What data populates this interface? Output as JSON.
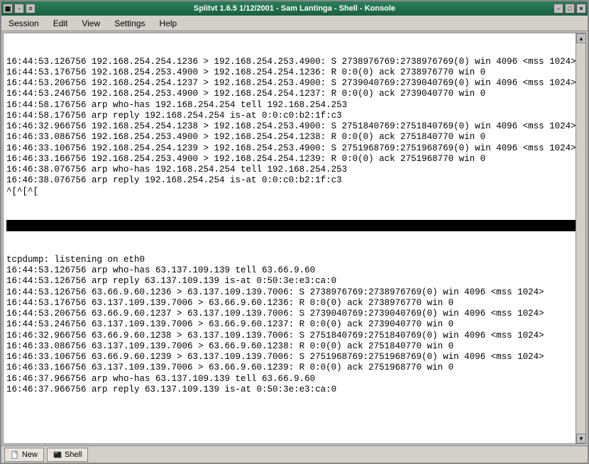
{
  "window": {
    "title": "Splitvt 1.6.5  1/12/2001  - Sam Lantinga - Shell - Konsole"
  },
  "menubar": {
    "session": "Session",
    "edit": "Edit",
    "view": "View",
    "settings": "Settings",
    "help": "Help"
  },
  "terminal": {
    "upper": [
      "16:44:53.126756 192.168.254.254.1236 > 192.168.254.253.4900: S 2738976769:2738976769(0) win 4096 <mss 1024>",
      "16:44:53.176756 192.168.254.253.4900 > 192.168.254.254.1236: R 0:0(0) ack 2738976770 win 0",
      "16:44:53.206756 192.168.254.254.1237 > 192.168.254.253.4900: S 2739040769:2739040769(0) win 4096 <mss 1024>",
      "16:44:53.246756 192.168.254.253.4900 > 192.168.254.254.1237: R 0:0(0) ack 2739040770 win 0",
      "16:44:58.176756 arp who-has 192.168.254.254 tell 192.168.254.253",
      "16:44:58.176756 arp reply 192.168.254.254 is-at 0:0:c0:b2:1f:c3",
      "16:46:32.966756 192.168.254.254.1238 > 192.168.254.253.4900: S 2751840769:2751840769(0) win 4096 <mss 1024>",
      "16:46:33.086756 192.168.254.253.4900 > 192.168.254.254.1238: R 0:0(0) ack 2751840770 win 0",
      "16:46:33.106756 192.168.254.254.1239 > 192.168.254.253.4900: S 2751968769:2751968769(0) win 4096 <mss 1024>",
      "16:46:33.166756 192.168.254.253.4900 > 192.168.254.254.1239: R 0:0(0) ack 2751968770 win 0",
      "16:46:38.076756 arp who-has 192.168.254.254 tell 192.168.254.253",
      "16:46:38.076756 arp reply 192.168.254.254 is-at 0:0:c0:b2:1f:c3",
      "^[^[^["
    ],
    "lower": [
      "tcpdump: listening on eth0",
      "16:44:53.126756 arp who-has 63.137.109.139 tell 63.66.9.60",
      "16:44:53.126756 arp reply 63.137.109.139 is-at 0:50:3e:e3:ca:0",
      "16:44:53.126756 63.66.9.60.1236 > 63.137.109.139.7006: S 2738976769:2738976769(0) win 4096 <mss 1024>",
      "16:44:53.176756 63.137.109.139.7006 > 63.66.9.60.1236: R 0:0(0) ack 2738976770 win 0",
      "16:44:53.206756 63.66.9.60.1237 > 63.137.109.139.7006: S 2739040769:2739040769(0) win 4096 <mss 1024>",
      "16:44:53.246756 63.137.109.139.7006 > 63.66.9.60.1237: R 0:0(0) ack 2739040770 win 0",
      "16:46:32.966756 63.66.9.60.1238 > 63.137.109.139.7006: S 2751840769:2751840769(0) win 4096 <mss 1024>",
      "16:46:33.086756 63.137.109.139.7006 > 63.66.9.60.1238: R 0:0(0) ack 2751840770 win 0",
      "16:46:33.106756 63.66.9.60.1239 > 63.137.109.139.7006: S 2751968769:2751968769(0) win 4096 <mss 1024>",
      "16:46:33.166756 63.137.109.139.7006 > 63.66.9.60.1239: R 0:0(0) ack 2751968770 win 0",
      "16:46:37.966756 arp who-has 63.137.109.139 tell 63.66.9.60",
      "16:46:37.966756 arp reply 63.137.109.139 is-at 0:50:3e:e3:ca:0"
    ]
  },
  "tabs": {
    "new": "New",
    "shell": "Shell"
  }
}
